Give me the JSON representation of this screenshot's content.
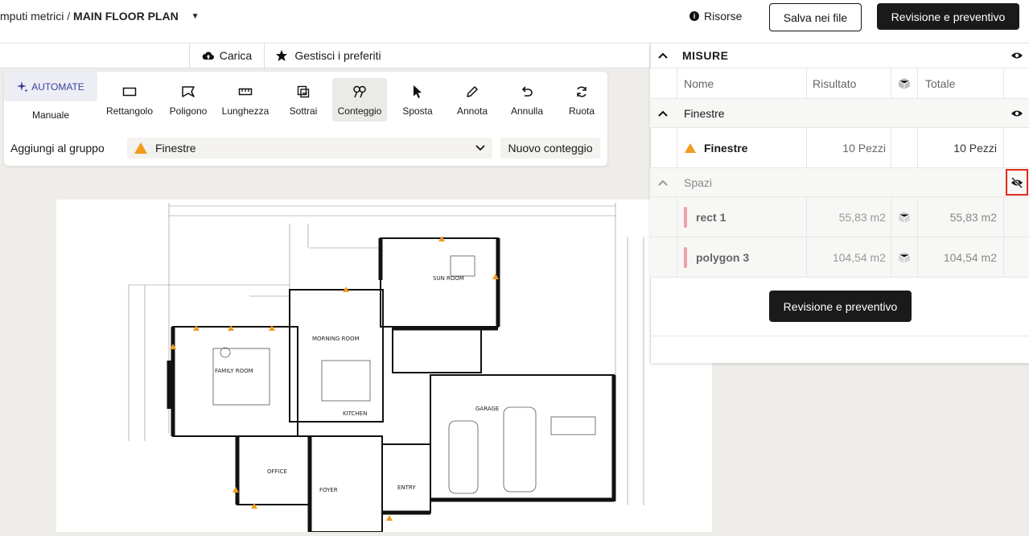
{
  "header": {
    "breadcrumb_parent": "mputi metrici",
    "breadcrumb_sep": "/",
    "breadcrumb_current": "MAIN FLOOR PLAN",
    "resources_label": "Risorse",
    "save_label": "Salva nei file",
    "review_label": "Revisione e preventivo"
  },
  "toolbar": {
    "upload_label": "Carica",
    "favorites_label": "Gestisci i preferiti"
  },
  "tools": {
    "automate_label": "AUTOMATE",
    "manual_label": "Manuale",
    "items": [
      {
        "label": "Rettangolo",
        "icon": "rectangle-icon"
      },
      {
        "label": "Poligono",
        "icon": "polygon-icon"
      },
      {
        "label": "Lunghezza",
        "icon": "ruler-icon"
      },
      {
        "label": "Sottrai",
        "icon": "subtract-icon"
      },
      {
        "label": "Conteggio",
        "icon": "count-icon",
        "active": true
      },
      {
        "label": "Sposta",
        "icon": "cursor-icon"
      },
      {
        "label": "Annota",
        "icon": "pencil-icon"
      },
      {
        "label": "Annulla",
        "icon": "undo-icon"
      },
      {
        "label": "Ruota",
        "icon": "rotate-icon"
      }
    ],
    "group_label": "Aggiungi al gruppo",
    "group_value": "Finestre",
    "new_count_label": "Nuovo conteggio"
  },
  "plan": {
    "labels": [
      "SUN ROOM",
      "MORNING ROOM",
      "FAMILY ROOM",
      "KITCHEN",
      "GARAGE",
      "OFFICE",
      "FOYER",
      "ENTRY"
    ]
  },
  "measures": {
    "title": "MISURE",
    "columns": {
      "name": "Nome",
      "result": "Risultato",
      "total": "Totale"
    },
    "groups": [
      {
        "name": "Finestre",
        "visible": true,
        "items": [
          {
            "name": "Finestre",
            "result": "10 Pezzi",
            "total": "10 Pezzi"
          }
        ]
      },
      {
        "name": "Spazi",
        "visible": false,
        "items": [
          {
            "name": "rect 1",
            "result": "55,83 m2",
            "total": "55,83 m2"
          },
          {
            "name": "polygon 3",
            "result": "104,54 m2",
            "total": "104,54 m2"
          }
        ]
      }
    ],
    "review_label": "Revisione e preventivo"
  },
  "colors": {
    "accent_dark": "#1a1a1a",
    "warning_orange": "#f29b1d",
    "area_pink": "#f2a0a8",
    "highlight_red": "#e5291c"
  }
}
